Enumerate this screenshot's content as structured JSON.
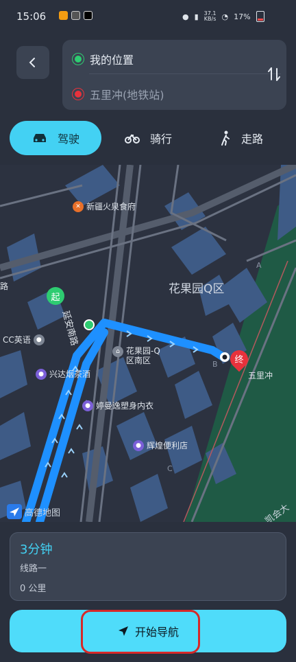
{
  "status_bar": {
    "time": "15:06",
    "net_speed": "37.1",
    "net_unit": "KB/s",
    "battery": "17%"
  },
  "route": {
    "origin": "我的位置",
    "destination": "五里冲(地铁站)"
  },
  "modes": [
    {
      "label": "驾驶",
      "icon": "car-icon",
      "active": true
    },
    {
      "label": "骑行",
      "icon": "bicycle-icon",
      "active": false
    },
    {
      "label": "走路",
      "icon": "walk-icon",
      "active": false
    }
  ],
  "map": {
    "pois": {
      "restaurant": "新疆火泉食府",
      "area": "花果园Q区",
      "cc": "CC英语",
      "tobacco": "兴达烟茶酒",
      "garden": "花果园-Q",
      "garden2": "区南区",
      "lingerie": "婷曼逸塑身内衣",
      "store": "辉煌便利店",
      "dest": "五里冲",
      "road": "延安南路",
      "road_left": "路",
      "side_road": "凯会大"
    },
    "markers": {
      "start": "起",
      "end": "终"
    },
    "letters": [
      "A",
      "B",
      "C"
    ],
    "logo": "高德地图"
  },
  "result": {
    "time": "3分钟",
    "line": "线路一",
    "distance": "0 公里"
  },
  "start_nav": "开始导航",
  "colors": {
    "accent": "#4fdcfa",
    "route": "#1e90ff",
    "start": "#2ecc71",
    "end": "#e8323c"
  }
}
